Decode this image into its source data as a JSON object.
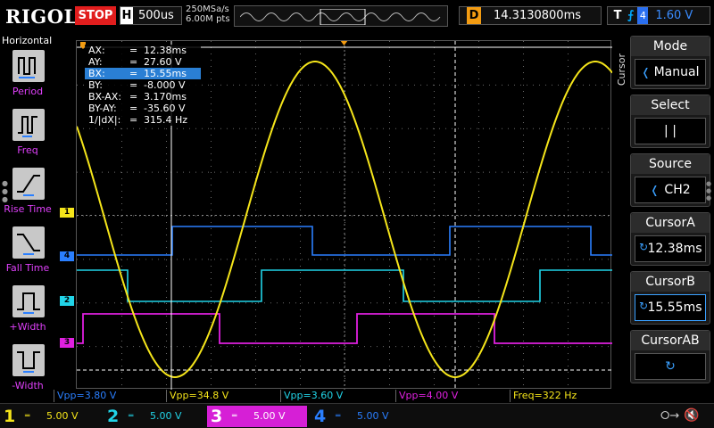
{
  "topbar": {
    "logo": "RIGOL",
    "run_state": "STOP",
    "horizontal_label": "H",
    "timebase": "500us",
    "sample_rate": "250MSa/s",
    "memory_depth": "6.00M pts",
    "delay_label": "D",
    "delay_value": "14.3130800ms",
    "trigger_label": "T",
    "trigger_source": "4",
    "trigger_level": "1.60 V"
  },
  "leftpanel": {
    "title": "Horizontal",
    "items": [
      {
        "label": "Period",
        "icon": "period-icon"
      },
      {
        "label": "Freq",
        "icon": "freq-icon"
      },
      {
        "label": "Rise Time",
        "icon": "rise-time-icon"
      },
      {
        "label": "Fall Time",
        "icon": "fall-time-icon"
      },
      {
        "label": "+Width",
        "icon": "pos-width-icon"
      },
      {
        "label": "-Width",
        "icon": "neg-width-icon"
      }
    ]
  },
  "cursor_readout": [
    {
      "key": "AX:",
      "value": "12.38ms",
      "selected": false
    },
    {
      "key": "AY:",
      "value": "27.60 V",
      "selected": false
    },
    {
      "key": "BX:",
      "value": "15.55ms",
      "selected": true
    },
    {
      "key": "BY:",
      "value": "-8.000 V",
      "selected": false
    },
    {
      "key": "BX-AX:",
      "value": "3.170ms",
      "selected": false
    },
    {
      "key": "BY-AY:",
      "value": "-35.60 V",
      "selected": false
    },
    {
      "key": "1/|dX|:",
      "value": "315.4 Hz",
      "selected": false
    }
  ],
  "channel_markers": [
    {
      "label": "1",
      "color": "#f5e51a"
    },
    {
      "label": "4",
      "color": "#2a7fff"
    },
    {
      "label": "2",
      "color": "#21d4e8"
    },
    {
      "label": "3",
      "color": "#e020e0"
    }
  ],
  "measurements": [
    {
      "text": "Vpp=3.80 V",
      "color": "#2a7fff"
    },
    {
      "text": "Vpp=34.8 V",
      "color": "#f5e51a"
    },
    {
      "text": "Vpp=3.60 V",
      "color": "#21d4e8"
    },
    {
      "text": "Vpp=4.00 V",
      "color": "#e020e0"
    },
    {
      "text": "Freq=322 Hz",
      "color": "#f5e51a"
    }
  ],
  "rightmenu": {
    "vertical_label": "Cursor",
    "items": [
      {
        "title": "Mode",
        "value": "Manual",
        "knob": false
      },
      {
        "title": "Select",
        "value": "|   |",
        "knob": false
      },
      {
        "title": "Source",
        "value": "CH2",
        "knob": false
      },
      {
        "title": "CursorA",
        "value": "12.38ms",
        "knob": true
      },
      {
        "title": "CursorB",
        "value": "15.55ms",
        "knob": true
      },
      {
        "title": "CursorAB",
        "value": "",
        "knob": true
      }
    ]
  },
  "channels": [
    {
      "num": "1",
      "scale": "5.00 V",
      "color": "#f5e51a",
      "active": false
    },
    {
      "num": "2",
      "scale": "5.00 V",
      "color": "#21d4e8",
      "active": false
    },
    {
      "num": "3",
      "scale": "5.00 V",
      "color": "#e020e0",
      "active": true
    },
    {
      "num": "4",
      "scale": "5.00 V",
      "color": "#2a7fff",
      "active": false
    }
  ],
  "colors": {
    "ch1": "#f5e51a",
    "ch2": "#21d4e8",
    "ch3": "#e020e0",
    "ch4": "#2a7fff",
    "trigger": "#f39c12",
    "grid": "#6a6a6a"
  }
}
